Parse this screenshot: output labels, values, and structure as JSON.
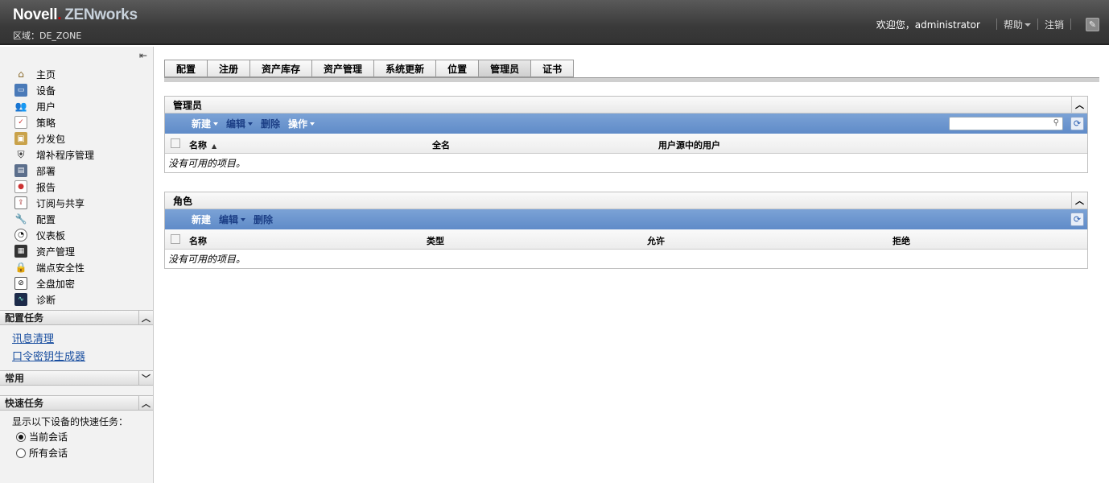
{
  "header": {
    "brand": "Novell",
    "product": "ZENworks",
    "zone": "区域：DE_ZONE",
    "welcome": "欢迎您，administrator",
    "help": "帮助",
    "logout": "注销"
  },
  "sidebar": {
    "nav": [
      {
        "label": "主页",
        "icon": "home-icon"
      },
      {
        "label": "设备",
        "icon": "monitor-icon"
      },
      {
        "label": "用户",
        "icon": "users-icon"
      },
      {
        "label": "策略",
        "icon": "policy-icon"
      },
      {
        "label": "分发包",
        "icon": "bundle-icon"
      },
      {
        "label": "增补程序管理",
        "icon": "shield-icon"
      },
      {
        "label": "部署",
        "icon": "deploy-icon"
      },
      {
        "label": "报告",
        "icon": "report-icon"
      },
      {
        "label": "订阅与共享",
        "icon": "subscribe-icon"
      },
      {
        "label": "配置",
        "icon": "wrench-icon"
      },
      {
        "label": "仪表板",
        "icon": "dashboard-icon"
      },
      {
        "label": "资产管理",
        "icon": "asset-icon"
      },
      {
        "label": "端点安全性",
        "icon": "lock-icon"
      },
      {
        "label": "全盘加密",
        "icon": "disk-icon"
      },
      {
        "label": "诊断",
        "icon": "diagnostics-icon"
      }
    ],
    "config_tasks": {
      "title": "配置任务",
      "links": [
        "讯息清理",
        "口令密钥生成器"
      ]
    },
    "common": {
      "title": "常用"
    },
    "quick_tasks": {
      "title": "快速任务",
      "desc": "显示以下设备的快速任务：",
      "options": [
        "当前会话",
        "所有会话"
      ],
      "selected": "当前会话"
    }
  },
  "tabs": [
    "配置",
    "注册",
    "资产库存",
    "资产管理",
    "系统更新",
    "位置",
    "管理员",
    "证书"
  ],
  "active_tab": "管理员",
  "admins": {
    "title": "管理员",
    "toolbar": {
      "new": "新建",
      "edit": "编辑",
      "delete": "删除",
      "actions": "操作"
    },
    "search_placeholder": "",
    "columns": [
      "名称",
      "全名",
      "用户源中的用户"
    ],
    "empty": "没有可用的项目。"
  },
  "roles": {
    "title": "角色",
    "toolbar": {
      "new": "新建",
      "edit": "编辑",
      "delete": "删除"
    },
    "columns": [
      "名称",
      "类型",
      "允许",
      "拒绝"
    ],
    "empty": "没有可用的项目。"
  },
  "colors": {
    "toolbar_blue": "#6a94cf",
    "link_blue": "#1a4fa0",
    "header_dark": "#3a3a3a"
  }
}
